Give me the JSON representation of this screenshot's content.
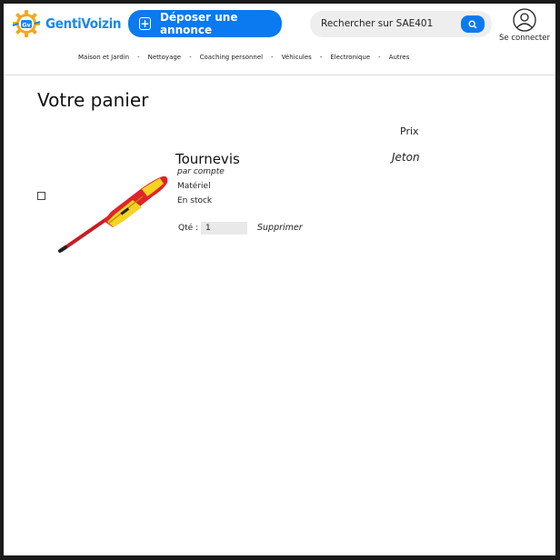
{
  "header": {
    "logo_text": "GentiVoizin",
    "logo_badge": "Gv",
    "deposit_label": "Déposer une annonce",
    "search": {
      "placeholder": "Rechercher sur SAE401"
    },
    "account_label": "Se connecter"
  },
  "categories": [
    {
      "label": "Maison et Jardin"
    },
    {
      "label": "Nettoyage"
    },
    {
      "label": "Coaching personnel"
    },
    {
      "label": "Véhicules"
    },
    {
      "label": "Électronique"
    },
    {
      "label": "Autres"
    }
  ],
  "separator": "-",
  "cart": {
    "title": "Votre panier",
    "price_header": "Prix",
    "item": {
      "name": "Tournevis",
      "seller_prefix": "par",
      "seller": "compte",
      "category": "Matériel",
      "stock": "En stock",
      "qty_label": "Qté :",
      "qty_value": "1",
      "delete_label": "Supprimer",
      "price": "Jeton",
      "image_icon": "screwdriver-image"
    }
  },
  "colors": {
    "accent": "#0b79f0",
    "logo": "#1a88e6",
    "logo_gear": "#f2a81d",
    "handle_red": "#e0242b",
    "handle_yellow": "#f5d321"
  }
}
